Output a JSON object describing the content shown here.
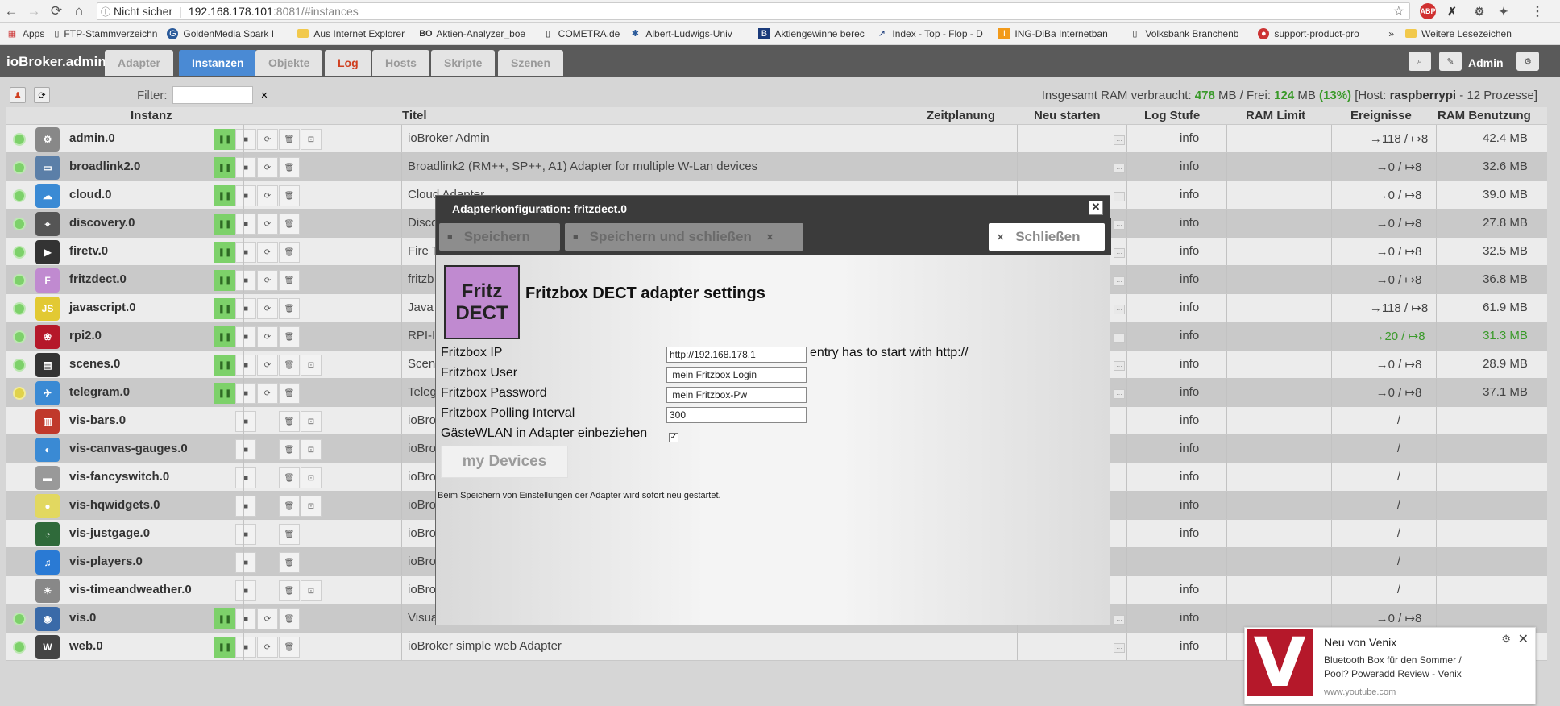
{
  "browser": {
    "security": "Nicht sicher",
    "url_host": "192.168.178.101",
    "url_rest": ":8081/#instances",
    "bookmarks": [
      "Apps",
      "FTP-Stammverzeichn",
      "GoldenMedia Spark I",
      "Aus Internet Explorer",
      "Aktien-Analyzer_boe",
      "COMETRA.de",
      "Albert-Ludwigs-Univ",
      "Aktiengewinne berec",
      "Index - Top - Flop - D",
      "ING-DiBa Internetban",
      "Volksbank Branchenb",
      "support-product-pro",
      "Weitere Lesezeichen"
    ]
  },
  "header": {
    "brand": "ioBroker.admin",
    "tabs": [
      "Adapter",
      "Instanzen",
      "Objekte",
      "Log",
      "Hosts",
      "Skripte",
      "Szenen"
    ],
    "user": "Admin"
  },
  "toolbar": {
    "filter_label": "Filter:",
    "filter_value": "",
    "ram_prefix": "Insgesamt RAM verbraucht: ",
    "ram_used": "478",
    "ram_mid": " MB / Frei: ",
    "ram_free": "124",
    "ram_unit": " MB ",
    "ram_percent": "(13%)",
    "host_prefix": " [Host: ",
    "host_name": "raspberrypi",
    "host_suffix": " - 12 Prozesse]"
  },
  "columns": [
    "Instanz",
    "Titel",
    "Zeitplanung",
    "Neu starten",
    "Log Stufe",
    "RAM Limit",
    "Ereignisse",
    "RAM Benutzung"
  ],
  "rows": [
    {
      "name": "admin.0",
      "title": "ioBroker Admin",
      "log": "info",
      "events": "→118 / ↦8",
      "ram": "42.4 MB"
    },
    {
      "name": "broadlink2.0",
      "title": "Broadlink2 (RM++, SP++, A1) Adapter for multiple W-Lan devices",
      "log": "info",
      "events": "→0 / ↦8",
      "ram": "32.6 MB"
    },
    {
      "name": "cloud.0",
      "title": "Cloud Adapter",
      "log": "info",
      "events": "→0 / ↦8",
      "ram": "39.0 MB"
    },
    {
      "name": "discovery.0",
      "title": "Disco",
      "log": "info",
      "events": "→0 / ↦8",
      "ram": "27.8 MB"
    },
    {
      "name": "firetv.0",
      "title": "Fire T",
      "log": "info",
      "events": "→0 / ↦8",
      "ram": "32.5 MB"
    },
    {
      "name": "fritzdect.0",
      "title": "fritzb",
      "log": "info",
      "events": "→0 / ↦8",
      "ram": "36.8 MB"
    },
    {
      "name": "javascript.0",
      "title": "Java",
      "log": "info",
      "events": "→118 / ↦8",
      "ram": "61.9 MB"
    },
    {
      "name": "rpi2.0",
      "title": "RPI-I",
      "log": "info",
      "events": "→20 / ↦8",
      "ram": "31.3 MB"
    },
    {
      "name": "scenes.0",
      "title": "Scen",
      "log": "info",
      "events": "→0 / ↦8",
      "ram": "28.9 MB"
    },
    {
      "name": "telegram.0",
      "title": "Teleg",
      "log": "info",
      "events": "→0 / ↦8",
      "ram": "37.1 MB"
    },
    {
      "name": "vis-bars.0",
      "title": "ioBro",
      "log": "info",
      "events": "/",
      "ram": ""
    },
    {
      "name": "vis-canvas-gauges.0",
      "title": "ioBro",
      "log": "info",
      "events": "/",
      "ram": ""
    },
    {
      "name": "vis-fancyswitch.0",
      "title": "ioBro",
      "log": "info",
      "events": "/",
      "ram": ""
    },
    {
      "name": "vis-hqwidgets.0",
      "title": "ioBro",
      "log": "info",
      "events": "/",
      "ram": ""
    },
    {
      "name": "vis-justgage.0",
      "title": "ioBro",
      "log": "info",
      "events": "/",
      "ram": ""
    },
    {
      "name": "vis-players.0",
      "title": "ioBro",
      "log": "",
      "events": "/",
      "ram": ""
    },
    {
      "name": "vis-timeandweather.0",
      "title": "ioBro",
      "log": "info",
      "events": "/",
      "ram": ""
    },
    {
      "name": "vis.0",
      "title": "Visua",
      "log": "info",
      "events": "→0 / ↦8",
      "ram": ""
    },
    {
      "name": "web.0",
      "title": "ioBroker simple web Adapter",
      "log": "info",
      "events": "",
      "ram": ""
    }
  ],
  "dialog": {
    "title": "Adapterkonfiguration: fritzdect.0",
    "save": "Speichern",
    "save_close": "Speichern und schließen",
    "close": "Schließen",
    "logo_line1": "Fritz",
    "logo_line2": "DECT",
    "heading": "Fritzbox DECT adapter settings",
    "ip_label": "Fritzbox IP",
    "ip_value": "http://192.168.178.1",
    "ip_hint": "entry has to start with http://",
    "user_label": "Fritzbox User",
    "user_value": " mein Fritzbox Login",
    "pw_label": "Fritzbox Password",
    "pw_value": " mein Fritzbox-Pw",
    "interval_label": "Fritzbox Polling Interval",
    "interval_value": "300",
    "guest_label": "GästeWLAN in Adapter einbeziehen",
    "devices_button": "my Devices",
    "note": "Beim Speichern von Einstellungen der Adapter wird sofort neu gestartet."
  },
  "toast": {
    "logo": "V",
    "title": "Neu von Venix",
    "body": "Bluetooth Box für den Sommer / Pool? Poweradd Review - Venix",
    "source": "www.youtube.com"
  }
}
